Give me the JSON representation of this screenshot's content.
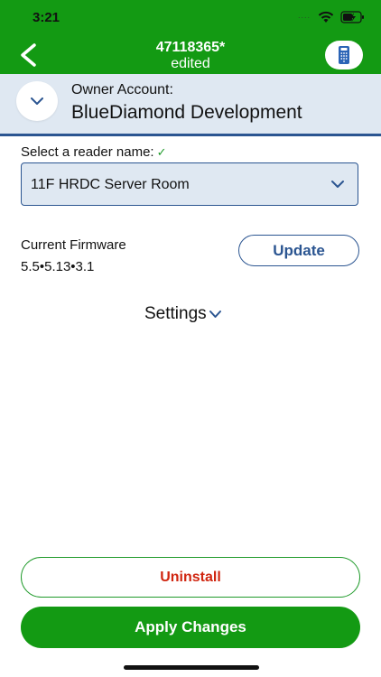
{
  "status_bar": {
    "time": "3:21",
    "signal": "....",
    "icons": [
      "wifi-icon",
      "battery-charging-icon"
    ]
  },
  "header": {
    "title": "47118365*",
    "subtitle": "edited",
    "background": "#139a13",
    "icons": [
      "back-arrow-icon",
      "device-reader-icon"
    ]
  },
  "owner": {
    "label": "Owner Account:",
    "name": "BlueDiamond Development",
    "icon": "chevron-down-icon"
  },
  "reader": {
    "label": "Select a reader name:",
    "check": "✓",
    "selected": "11F HRDC Server Room"
  },
  "firmware": {
    "label": "Current Firmware",
    "version": "5.5•5.13•3.1",
    "update_label": "Update"
  },
  "settings": {
    "label": "Settings"
  },
  "actions": {
    "uninstall_label": "Uninstall",
    "apply_label": "Apply Changes"
  },
  "colors": {
    "brand_green": "#139a13",
    "accent_blue": "#2b5591",
    "danger_red": "#d0250f",
    "panel_blue": "#dfe8f2"
  }
}
